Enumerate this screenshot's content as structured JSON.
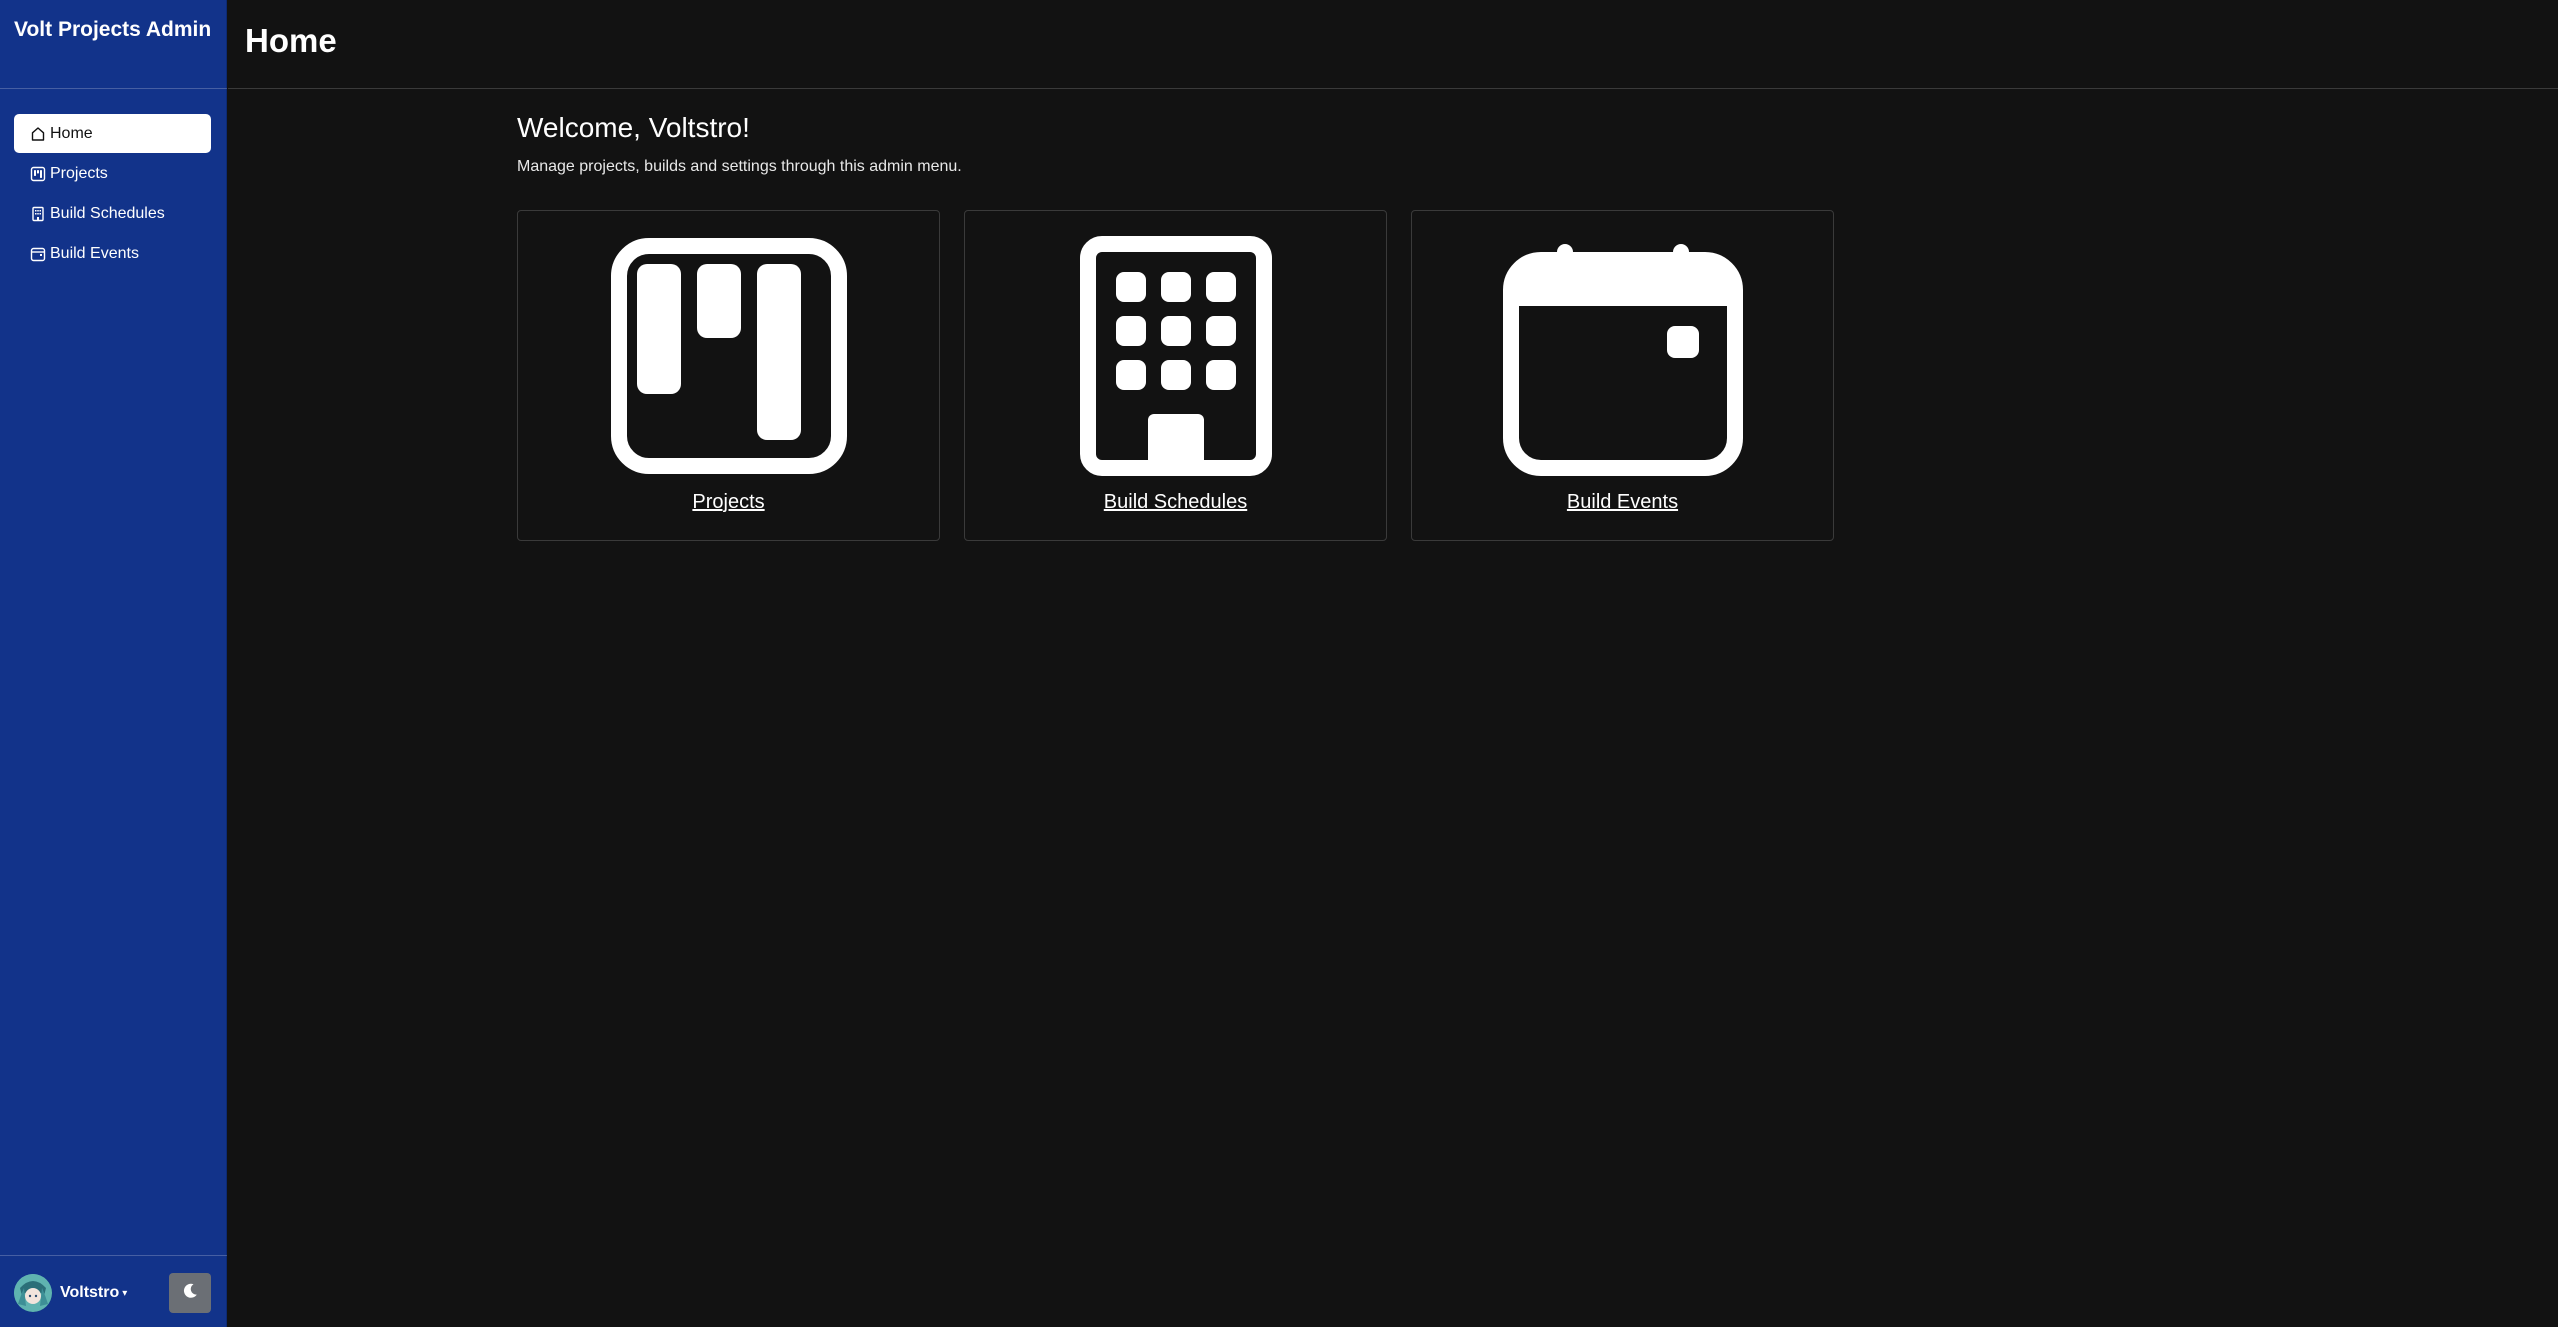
{
  "sidebar": {
    "brand": "Volt Projects Admin",
    "items": [
      {
        "label": "Home",
        "icon": "home-icon",
        "active": true
      },
      {
        "label": "Projects",
        "icon": "kanban-icon",
        "active": false
      },
      {
        "label": "Build Schedules",
        "icon": "building-icon",
        "active": false
      },
      {
        "label": "Build Events",
        "icon": "calendar-icon",
        "active": false
      }
    ],
    "user": {
      "name": "Voltstro",
      "caret": "▾"
    },
    "theme_toggle_icon": "moon-icon"
  },
  "header": {
    "title": "Home"
  },
  "main": {
    "welcome": "Welcome, Voltstro!",
    "subtitle": "Manage projects, builds and settings through this admin menu.",
    "cards": [
      {
        "label": "Projects",
        "icon": "kanban-icon"
      },
      {
        "label": "Build Schedules",
        "icon": "building-icon"
      },
      {
        "label": "Build Events",
        "icon": "calendar-icon"
      }
    ]
  },
  "colors": {
    "sidebar_bg": "#12338a",
    "page_bg": "#121212",
    "active_item_bg": "#ffffff",
    "theme_button_bg": "#6b6f75"
  }
}
